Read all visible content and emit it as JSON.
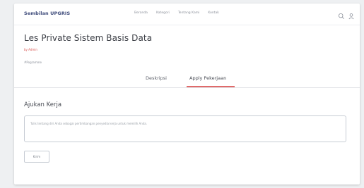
{
  "navbar": {
    "brand": "Sembilan UPGRIS",
    "links": [
      "Beranda",
      "Kategori",
      "Tentang Kami",
      "Kontak"
    ],
    "icons": [
      "search-icon",
      "user-icon"
    ]
  },
  "job": {
    "title": "Les Private Sistem Basis Data",
    "author": "by Admin",
    "category": "#Pogramme"
  },
  "tabs": [
    {
      "label": "Deskripsi",
      "active": false
    },
    {
      "label": "Apply Pekerjaan",
      "active": true
    }
  ],
  "apply_form": {
    "heading": "Ajukan Kerja",
    "textarea_placeholder": "Tulis tentang diri Anda sebagai pertimbangan penyedia kerja untuk memilih Anda.",
    "submit_label": "Kirim"
  },
  "colors": {
    "brand": "#3d4a7a",
    "accent": "#e06a6a",
    "author": "#d9534f"
  }
}
